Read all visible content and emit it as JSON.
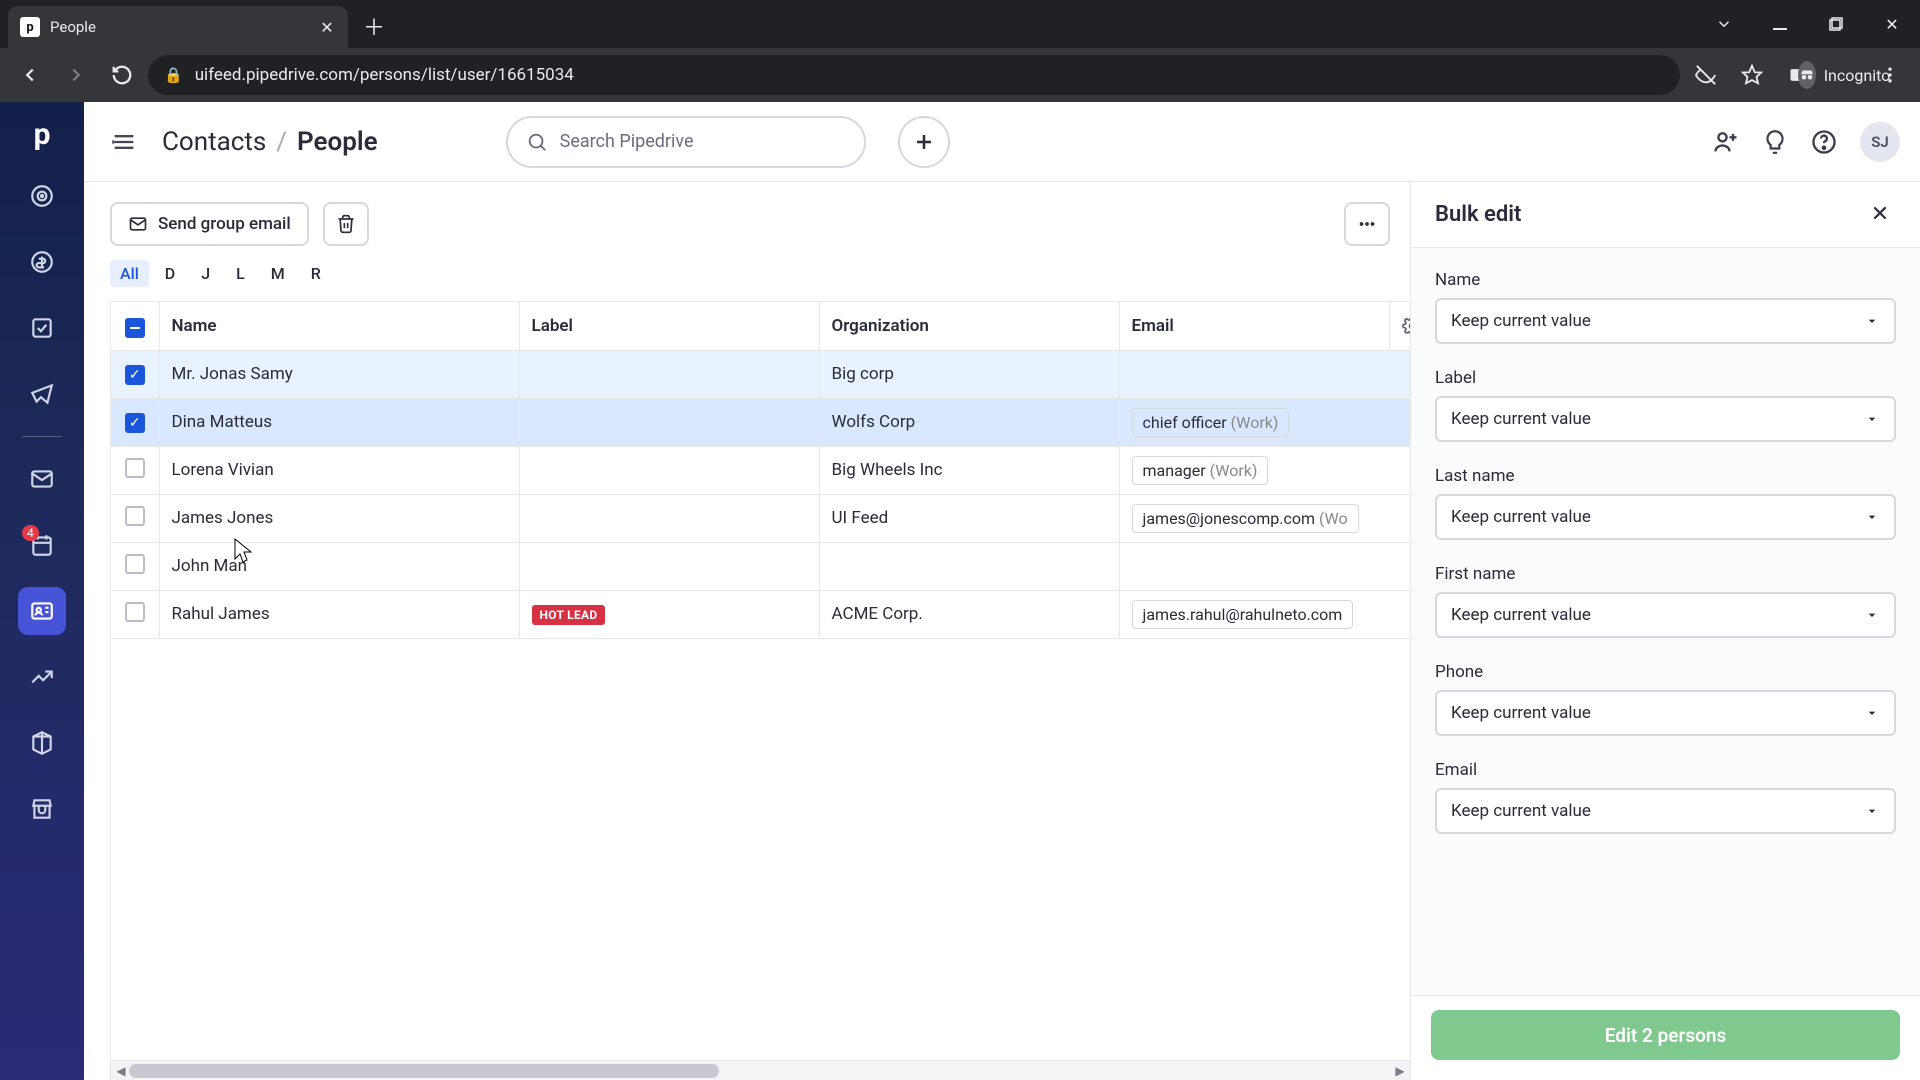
{
  "browser": {
    "tab_title": "People",
    "url": "uifeed.pipedrive.com/persons/list/user/16615034",
    "incognito_label": "Incognito"
  },
  "header": {
    "breadcrumb_root": "Contacts",
    "breadcrumb_current": "People",
    "search_placeholder": "Search Pipedrive",
    "avatar_initials": "SJ"
  },
  "sidenav": {
    "badge_count": "4"
  },
  "toolbar": {
    "send_email_label": "Send group email",
    "letters": [
      "All",
      "D",
      "J",
      "L",
      "M",
      "R"
    ],
    "active_letter": "All"
  },
  "table": {
    "headers": {
      "name": "Name",
      "label": "Label",
      "org": "Organization",
      "email": "Email"
    },
    "rows": [
      {
        "selected": true,
        "name": "Mr. Jonas Samy",
        "label": "",
        "org": "Big corp",
        "email": ""
      },
      {
        "selected": true,
        "name": "Dina Matteus",
        "label": "",
        "org": "Wolfs Corp",
        "email_chip": {
          "main": "chief officer",
          "muted": "(Work)"
        }
      },
      {
        "selected": false,
        "name": "Lorena Vivian",
        "label": "",
        "org": "Big Wheels Inc",
        "email_chip": {
          "main": "manager",
          "muted": "(Work)"
        }
      },
      {
        "selected": false,
        "name": "James Jones",
        "label": "",
        "org": "UI Feed",
        "email_chip": {
          "main": "james@jonescomp.com",
          "muted": "(Wo"
        }
      },
      {
        "selected": false,
        "name": "John Man",
        "label": "",
        "org": "",
        "email": ""
      },
      {
        "selected": false,
        "name": "Rahul James",
        "label": "HOT LEAD",
        "org": "ACME Corp.",
        "email_chip": {
          "main": "james.rahul@rahulneto.com",
          "muted": ""
        }
      }
    ]
  },
  "panel": {
    "title": "Bulk edit",
    "keep_value_label": "Keep current value",
    "fields": [
      "Name",
      "Label",
      "Last name",
      "First name",
      "Phone",
      "Email"
    ],
    "submit_label": "Edit 2 persons"
  }
}
